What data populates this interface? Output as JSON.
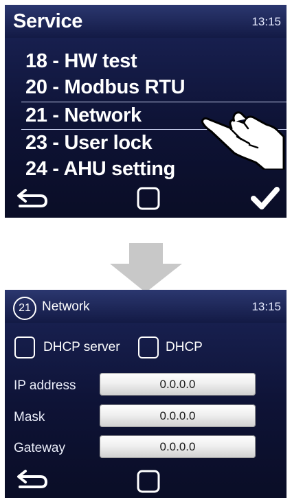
{
  "screen1": {
    "title": "Service",
    "time": "13:15",
    "menu": [
      {
        "label": "18 - HW test"
      },
      {
        "label": "20 - Modbus RTU"
      },
      {
        "label": "21 - Network",
        "selected": true
      },
      {
        "label": "23 - User lock"
      },
      {
        "label": "24 - AHU setting"
      }
    ],
    "footer": {
      "back_icon": "back-arrow-icon",
      "home_icon": "square-icon",
      "confirm_icon": "checkmark-icon"
    },
    "pointer_icon": "tapping-hand-icon"
  },
  "transition_icon": "down-arrow-icon",
  "screen2": {
    "badge": "21",
    "title": "Network",
    "time": "13:15",
    "checkboxes": [
      {
        "label": "DHCP server",
        "checked": false
      },
      {
        "label": "DHCP",
        "checked": false
      }
    ],
    "fields": [
      {
        "label": "IP address",
        "value": "0.0.0.0"
      },
      {
        "label": "Mask",
        "value": "0.0.0.0"
      },
      {
        "label": "Gateway",
        "value": "0.0.0.0"
      }
    ],
    "footer": {
      "back_icon": "back-arrow-icon",
      "home_icon": "square-icon"
    }
  },
  "colors": {
    "screen_bg": "#0e1336",
    "header_bg": "#2b376f",
    "field_bg": "#f0f0f0",
    "text": "#ffffff",
    "arrow": "#c8c8c8"
  }
}
